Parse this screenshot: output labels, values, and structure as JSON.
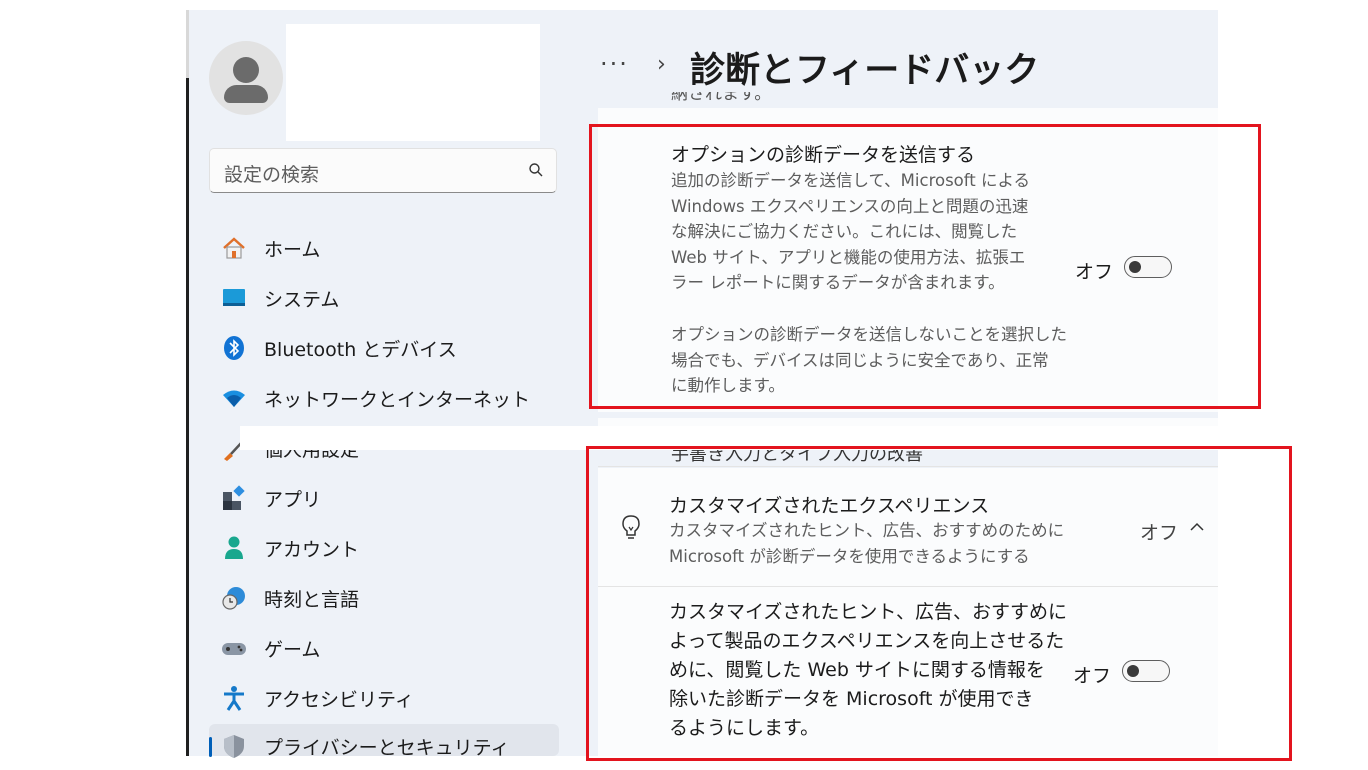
{
  "header": {
    "breadcrumb_more": "···",
    "breadcrumb_sep": "›",
    "title": "診断とフィードバック"
  },
  "search": {
    "placeholder": "設定の検索"
  },
  "sidebar": {
    "items": [
      {
        "label": "ホーム",
        "icon": "home-icon"
      },
      {
        "label": "システム",
        "icon": "system-icon"
      },
      {
        "label": "Bluetooth とデバイス",
        "icon": "bluetooth-icon"
      },
      {
        "label": "ネットワークとインターネット",
        "icon": "wifi-icon"
      },
      {
        "label": "個人用設定",
        "icon": "brush-icon"
      },
      {
        "label": "アプリ",
        "icon": "apps-icon"
      },
      {
        "label": "アカウント",
        "icon": "account-icon"
      },
      {
        "label": "時刻と言語",
        "icon": "time-language-icon"
      },
      {
        "label": "ゲーム",
        "icon": "gamepad-icon"
      },
      {
        "label": "アクセシビリティ",
        "icon": "accessibility-icon"
      },
      {
        "label": "プライバシーとセキュリティ",
        "icon": "shield-icon",
        "active": true
      }
    ]
  },
  "optional_data": {
    "cut_top": "納されます。",
    "title": "オプションの診断データを送信する",
    "description_lines": [
      "追加の診断データを送信して、Microsoft による",
      "Windows エクスペリエンスの向上と問題の迅速",
      "な解決にご協力ください。これには、閲覧した",
      "Web サイト、アプリと機能の使用方法、拡張エ",
      "ラー レポートに関するデータが含まれます。"
    ],
    "note_lines": [
      "オプションの診断データを送信しないことを選択した",
      "場合でも、デバイスは同じように安全であり、正常",
      "に動作します。"
    ],
    "state": "オフ"
  },
  "inking_cut": "手書き入力とタイプ入力の改善",
  "tailored": {
    "title": "カスタマイズされたエクスペリエンス",
    "description_lines": [
      "カスタマイズされたヒント、広告、おすすめのために",
      "Microsoft が診断データを使用できるようにする"
    ],
    "state": "オフ",
    "expand_icon": "chevron-up-icon",
    "body_lines": [
      "カスタマイズされたヒント、広告、おすすめに",
      "よって製品のエクスペリエンスを向上させるた",
      "めに、閲覧した Web サイトに関する情報を",
      "除いた診断データを Microsoft が使用でき",
      "るようにします。"
    ],
    "body_state": "オフ"
  },
  "colors": {
    "accent": "#005fb8",
    "highlight_box": "#e3141e"
  }
}
